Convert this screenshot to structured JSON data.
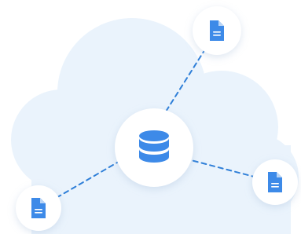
{
  "illustration": {
    "colors": {
      "background": "#ffffff",
      "cloud": "#eaf3fc",
      "connector": "#2f7fd8",
      "node_fill": "#ffffff",
      "node_shadow": "#9fb8d6",
      "icon": "#3d8ae8",
      "icon_fold": "#b8d4f6",
      "icon_lines": "#ffffff"
    },
    "hub": {
      "icon": "database-icon"
    },
    "nodes": [
      {
        "icon": "document-icon",
        "position": "top-right"
      },
      {
        "icon": "document-icon",
        "position": "right"
      },
      {
        "icon": "document-icon",
        "position": "bottom-left"
      }
    ]
  }
}
